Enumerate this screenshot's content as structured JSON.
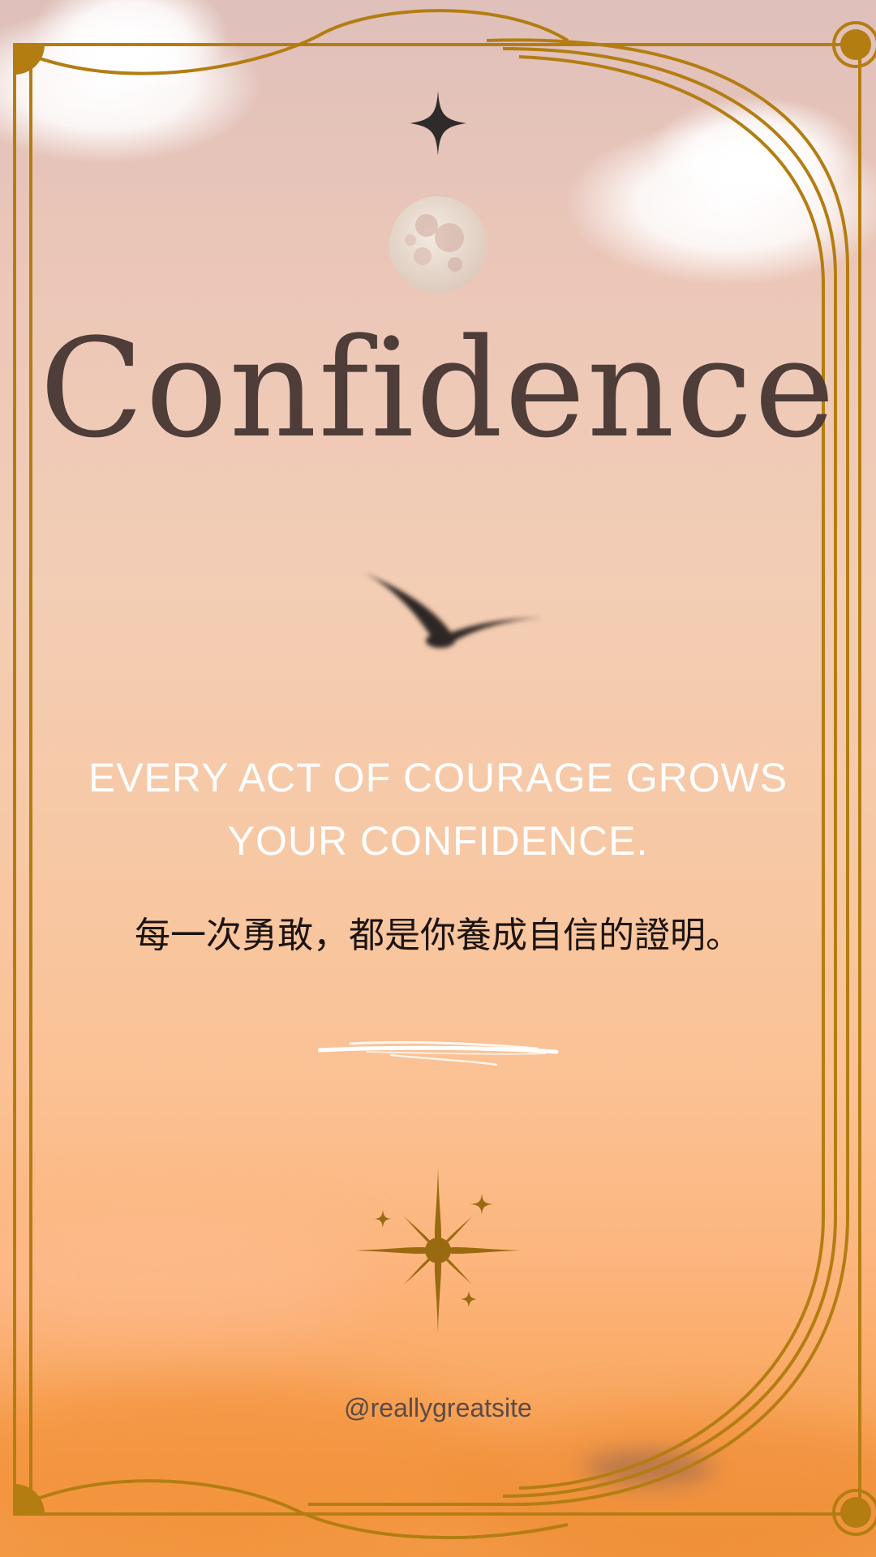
{
  "poster": {
    "title": "Confidence",
    "quote_en": "EVERY ACT OF COURAGE GROWS YOUR CONFIDENCE.",
    "quote_zh": "每一次勇敢，都是你養成自信的證明。",
    "handle": "@reallygreatsite"
  },
  "colors": {
    "frame_gold": "#b37d12",
    "title_brown": "#4e3d38",
    "star_dark": "#2f2b2b",
    "sparkle_gold": "#9a6a10",
    "quote_en_white": "#ffffff",
    "quote_zh_black": "#1c1412"
  },
  "icons": {
    "top_star": "four-point-star-icon",
    "moon": "full-moon-icon",
    "bird": "flying-bird-icon",
    "brush": "brush-stroke",
    "sparkle": "sparkle-cluster-icon"
  }
}
